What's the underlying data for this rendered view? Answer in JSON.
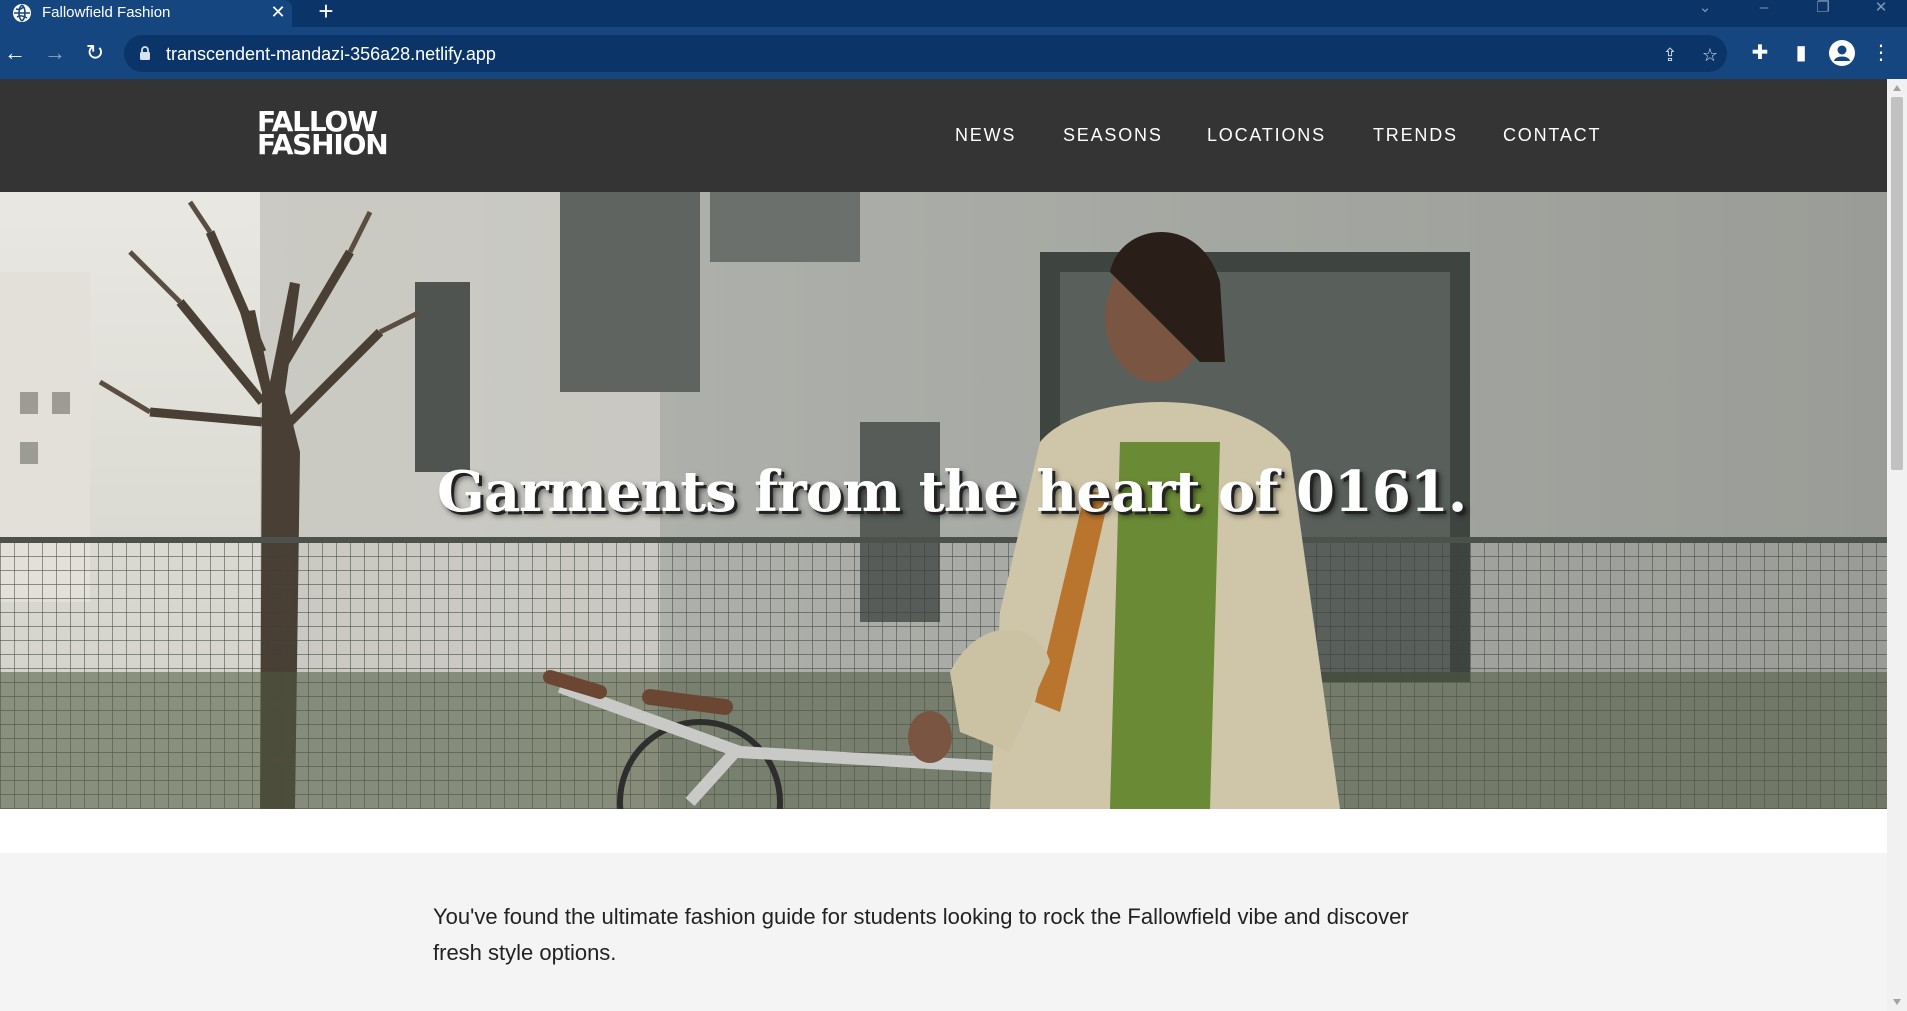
{
  "browser": {
    "tab_title": "Fallowfield Fashion",
    "url": "transcendent-mandazi-356a28.netlify.app"
  },
  "site": {
    "logo_line1": "FALLOW",
    "logo_line2": "FASHION",
    "nav": [
      "NEWS",
      "SEASONS",
      "LOCATIONS",
      "TRENDS",
      "CONTACT"
    ]
  },
  "hero": {
    "headline": "Garments from the heart of 0161."
  },
  "intro": {
    "paragraph1": "You've found the ultimate fashion guide for students looking to rock the Fallowfield vibe and discover fresh style options."
  },
  "colors": {
    "browser_frame": "#0b3568",
    "browser_toolbar": "#15467f",
    "site_header": "#343434",
    "intro_bg": "#f4f4f4"
  }
}
